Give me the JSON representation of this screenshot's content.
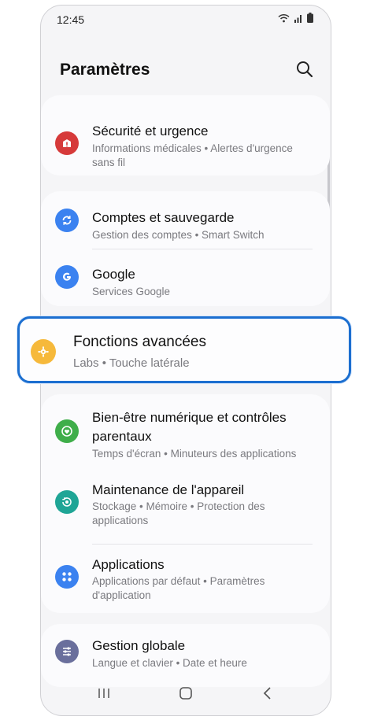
{
  "status_bar": {
    "time": "12:45"
  },
  "header": {
    "title": "Paramètres"
  },
  "cards": {
    "security": {
      "title": "Sécurité et urgence",
      "subtitle": "Informations médicales  •  Alertes d'urgence sans fil"
    },
    "accounts": {
      "title": "Comptes et sauvegarde",
      "subtitle": "Gestion des comptes  •  Smart Switch"
    },
    "google": {
      "title": "Google",
      "subtitle": "Services Google"
    },
    "advanced": {
      "title": "Fonctions avancées",
      "subtitle": "Labs  •  Touche latérale"
    },
    "wellbeing": {
      "title": "Bien-être numérique et contrôles parentaux",
      "subtitle": "Temps d'écran  •  Minuteurs des applications"
    },
    "maintenance": {
      "title": "Maintenance de l'appareil",
      "subtitle": "Stockage  •  Mémoire  •  Protection des applications"
    },
    "apps": {
      "title": "Applications",
      "subtitle": "Applications par défaut  •  Paramètres d'application"
    },
    "general": {
      "title": "Gestion globale",
      "subtitle": "Langue et clavier  •  Date et heure"
    }
  },
  "colors": {
    "highlight_border": "#1c6fd0",
    "security_icon": "#d63a3a",
    "accounts_icon": "#3b82f0",
    "google_icon": "#3b82f0",
    "advanced_icon": "#f6b93b",
    "wellbeing_icon": "#3fae4a",
    "maintenance_icon": "#1fa596",
    "apps_icon": "#3b82f0",
    "general_icon": "#6a6f9c"
  }
}
